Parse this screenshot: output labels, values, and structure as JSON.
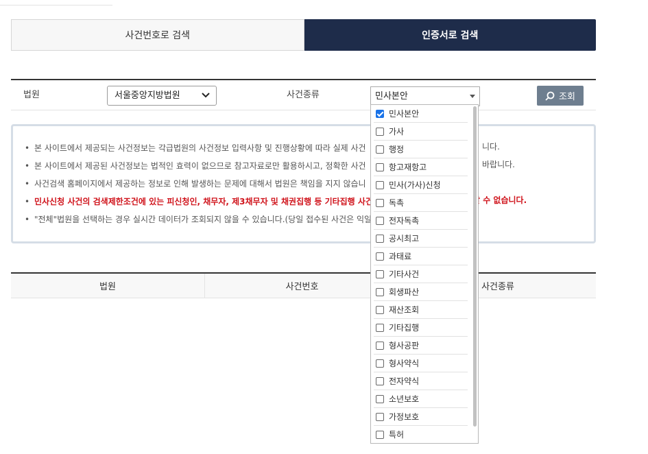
{
  "tabs": {
    "by_case_number": "사건번호로 검색",
    "by_certificate": "인증서로 검색"
  },
  "form": {
    "court_label": "법원",
    "court_value": "서울중앙지방법원",
    "case_type_label": "사건종류",
    "case_type_value": "민사본안",
    "search_button": "조회"
  },
  "notices": [
    "본 사이트에서 제공되는 사건정보는 각급법원의 사건정보 입력사항 및 진행상황에 따라 실제 사건",
    "본 사이트에서 제공된 사건정보는 법적인 효력이 없으므로 참고자료로만 활용하시고, 정확한 사건",
    "사건검색 홈페이지에서 제공하는 정보로 인해 발생하는 문제에 대해서 법원은 책임을 지지 않습니",
    "민사신청 사건의 검색제한조건에 있는 피신청인, 채무자, 제3채무자 및 채권집행 등 기타집행 사건",
    "\"전체\"법원을 선택하는 경우 실시간 데이터가 조회되지 않을 수 있습니다.(당일 접수된 사건은 익일"
  ],
  "notice_tails": [
    "니다.",
    "바랍니다.",
    "",
    "할 수 없습니다.",
    ""
  ],
  "result_table": {
    "headers": [
      "법원",
      "사건번호",
      "사건종류"
    ]
  },
  "case_type_options": [
    {
      "label": "민사본안",
      "checked": true
    },
    {
      "label": "가사",
      "checked": false
    },
    {
      "label": "행정",
      "checked": false
    },
    {
      "label": "항고재항고",
      "checked": false
    },
    {
      "label": "민사(가사)신청",
      "checked": false
    },
    {
      "label": "독촉",
      "checked": false
    },
    {
      "label": "전자독촉",
      "checked": false
    },
    {
      "label": "공시최고",
      "checked": false
    },
    {
      "label": "과태료",
      "checked": false
    },
    {
      "label": "기타사건",
      "checked": false
    },
    {
      "label": "회생파산",
      "checked": false
    },
    {
      "label": "재산조회",
      "checked": false
    },
    {
      "label": "기타집행",
      "checked": false
    },
    {
      "label": "형사공판",
      "checked": false
    },
    {
      "label": "형사약식",
      "checked": false
    },
    {
      "label": "전자약식",
      "checked": false
    },
    {
      "label": "소년보호",
      "checked": false
    },
    {
      "label": "가정보호",
      "checked": false
    },
    {
      "label": "특허",
      "checked": false
    }
  ],
  "colors": {
    "active_tab": "#1e2c4a",
    "search_button": "#6e7e8f",
    "warning_text": "#d0141c",
    "checkbox_checked": "#1a73e8"
  }
}
